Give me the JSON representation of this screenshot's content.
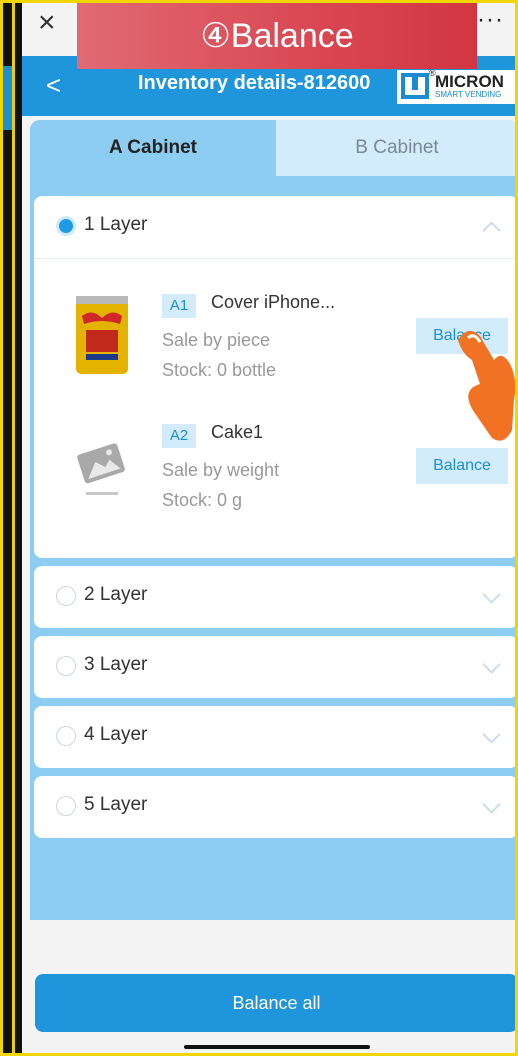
{
  "overlay": {
    "step_banner": "④Balance"
  },
  "topbar": {
    "close": "×",
    "more": "···"
  },
  "header": {
    "back": "<",
    "title": "Inventory details-812600",
    "logo": {
      "mark": "Ⓜ",
      "text": "MICRON",
      "sub": "SMART VENDING",
      "registered": "®"
    }
  },
  "tabs": [
    {
      "label": "A Cabinet",
      "active": true
    },
    {
      "label": "B Cabinet",
      "active": false
    }
  ],
  "layers": [
    {
      "label": "1 Layer",
      "selected": true,
      "expanded": true,
      "items": [
        {
          "slot": "A1",
          "name": "Cover iPhone...",
          "sale": "Sale by piece",
          "stock": "Stock: 0 bottle",
          "button": "Balance",
          "image": "energy-drink-can-icon"
        },
        {
          "slot": "A2",
          "name": "Cake1",
          "sale": "Sale by weight",
          "stock": "Stock: 0 g",
          "button": "Balance",
          "image": "placeholder-image-icon"
        }
      ]
    },
    {
      "label": "2 Layer",
      "selected": false,
      "expanded": false
    },
    {
      "label": "3 Layer",
      "selected": false,
      "expanded": false
    },
    {
      "label": "4 Layer",
      "selected": false,
      "expanded": false
    },
    {
      "label": "5 Layer",
      "selected": false,
      "expanded": false
    }
  ],
  "footer": {
    "balance_all": "Balance all"
  },
  "colors": {
    "primary": "#1f95dc",
    "panel": "#8ecdf2",
    "tag_bg": "#d2ecfb",
    "banner": "#d94752",
    "hand": "#f07222"
  }
}
